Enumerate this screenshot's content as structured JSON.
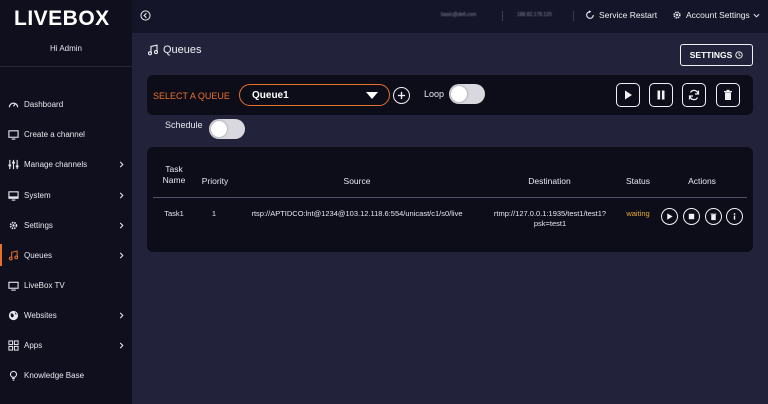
{
  "app": {
    "logo": "LIVEBOX",
    "user_greeting": "Hi Admin"
  },
  "sidebar": {
    "items": [
      {
        "label": "Dashboard",
        "icon": "gauge-icon",
        "chevron": false,
        "active": false
      },
      {
        "label": "Create a channel",
        "icon": "monitor-icon",
        "chevron": false,
        "active": false
      },
      {
        "label": "Manage channels",
        "icon": "sliders-icon",
        "chevron": true,
        "active": false
      },
      {
        "label": "System",
        "icon": "desktop-icon",
        "chevron": true,
        "active": false
      },
      {
        "label": "Settings",
        "icon": "gear-icon",
        "chevron": true,
        "active": false
      },
      {
        "label": "Queues",
        "icon": "music-icon",
        "chevron": true,
        "active": true
      },
      {
        "label": "LiveBox TV",
        "icon": "tv-icon",
        "chevron": false,
        "active": false
      },
      {
        "label": "Websites",
        "icon": "globe-icon",
        "chevron": true,
        "active": false
      },
      {
        "label": "Apps",
        "icon": "grid-icon",
        "chevron": true,
        "active": false
      },
      {
        "label": "Knowledge Base",
        "icon": "lightbulb-icon",
        "chevron": false,
        "active": false
      }
    ],
    "accent": "#e8702a"
  },
  "topbar": {
    "email_blurred": "basic@dell.com",
    "ip_blurred": "188.82.178.120",
    "service_restart": "Service Restart",
    "account_settings": "Account Settings"
  },
  "page": {
    "title": "Queues",
    "settings_button": "SETTINGS"
  },
  "queue_controls": {
    "select_label": "SELECT A QUEUE",
    "selected_queue": "Queue1",
    "loop_label": "Loop",
    "loop_on": false,
    "schedule_label": "Schedule",
    "schedule_on": false
  },
  "table": {
    "headers": {
      "task_name_1": "Task",
      "task_name_2": "Name",
      "priority": "Priority",
      "source": "Source",
      "destination": "Destination",
      "status": "Status",
      "actions": "Actions"
    },
    "rows": [
      {
        "task_name": "Task1",
        "priority": "1",
        "source": "rtsp://APTIDCO:lnt@1234@103.12.118.6:554/unicast/c1/s0/live",
        "destination_1": "rtmp://127.0.0.1:1935/test1/test1?",
        "destination_2": "psk=test1",
        "status": "waiting"
      }
    ]
  },
  "colors": {
    "background": "#22223a",
    "panel": "#0d0d1a",
    "sidebar": "#0f0f1d",
    "status_waiting": "#e8a92a"
  }
}
